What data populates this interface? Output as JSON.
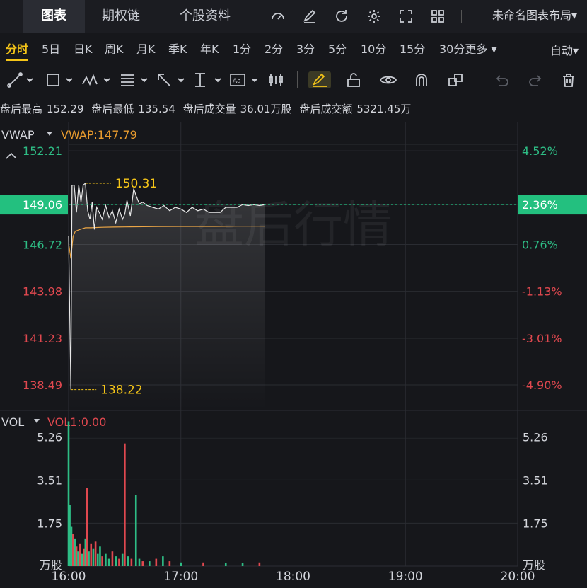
{
  "top_tabs": [
    {
      "label": "图表",
      "active": true
    },
    {
      "label": "期权链",
      "active": false
    },
    {
      "label": "个股资料",
      "active": false
    }
  ],
  "top_icons": [
    "gauge-icon",
    "edit-icon",
    "refresh-icon",
    "gear-icon",
    "fullscreen-icon",
    "grid-icon"
  ],
  "layout_name": "未命名图表布局",
  "periods": [
    {
      "label": "分时",
      "active": true
    },
    {
      "label": "5日"
    },
    {
      "label": "日K"
    },
    {
      "label": "周K"
    },
    {
      "label": "月K"
    },
    {
      "label": "季K"
    },
    {
      "label": "年K"
    },
    {
      "label": "1分"
    },
    {
      "label": "2分"
    },
    {
      "label": "3分"
    },
    {
      "label": "5分"
    },
    {
      "label": "10分"
    },
    {
      "label": "15分"
    },
    {
      "label": "30分更多"
    }
  ],
  "auto_label": "自动",
  "stats": {
    "high_label": "盘后最高",
    "high": "152.29",
    "low_label": "盘后最低",
    "low": "135.54",
    "vol_label": "盘后成交量",
    "vol": "36.01万股",
    "amt_label": "盘后成交额",
    "amt": "5321.45万"
  },
  "colors": {
    "up": "#2ebd85",
    "down": "#e0484f",
    "accent": "#f5c518",
    "vwap": "#e89b2e",
    "price": "#e8e8e8",
    "current": "#23c07f"
  },
  "chart_data": [
    {
      "type": "line",
      "indicator_name": "VWAP",
      "indicator_value": "VWAP:147.79",
      "watermark": "盘后行情",
      "x_ticks": [
        "16:00",
        "17:00",
        "18:00",
        "19:00",
        "20:00"
      ],
      "x_range_hours": [
        16,
        20
      ],
      "y_ticks_left": [
        "152.21",
        "146.72",
        "143.98",
        "141.23",
        "138.49"
      ],
      "y_ticks_left_values": [
        152.21,
        146.72,
        143.98,
        141.23,
        138.49
      ],
      "y_ticks_right": [
        "4.52%",
        "0.76%",
        "-1.13%",
        "-3.01%",
        "-4.90%"
      ],
      "ylim": [
        137.0,
        153.5
      ],
      "current_price": "149.06",
      "current_pct": "2.36%",
      "current_value": 149.06,
      "max_label": "150.31",
      "max_value": 150.31,
      "max_time": 16.15,
      "min_label": "138.22",
      "min_value": 138.22,
      "min_time": 16.02,
      "series": [
        {
          "role": "price",
          "x": [
            16.0,
            16.02,
            16.03,
            16.05,
            16.07,
            16.09,
            16.11,
            16.13,
            16.15,
            16.17,
            16.19,
            16.21,
            16.23,
            16.25,
            16.28,
            16.3,
            16.33,
            16.36,
            16.39,
            16.42,
            16.45,
            16.48,
            16.5,
            16.52,
            16.55,
            16.58,
            16.6,
            16.63,
            16.66,
            16.7,
            16.75,
            16.8,
            16.85,
            16.9,
            16.95,
            17.0,
            17.05,
            17.1,
            17.15,
            17.2,
            17.25,
            17.3,
            17.35,
            17.4,
            17.45,
            17.5,
            17.55,
            17.6,
            17.65,
            17.7,
            17.75
          ],
          "y": [
            147.2,
            138.22,
            150.2,
            150.2,
            148.6,
            150.2,
            149.2,
            150.2,
            150.31,
            148.7,
            148.2,
            149.2,
            147.6,
            148.9,
            148.5,
            148.2,
            149.0,
            148.3,
            148.7,
            148.0,
            148.8,
            148.2,
            148.5,
            149.3,
            148.4,
            150.0,
            149.6,
            149.1,
            149.2,
            149.0,
            148.9,
            148.8,
            149.0,
            148.7,
            148.9,
            148.8,
            148.6,
            148.9,
            148.7,
            148.8,
            148.6,
            148.6,
            148.6,
            148.9,
            148.9,
            148.9,
            149.06,
            149.0,
            149.06,
            149.0,
            149.06
          ]
        },
        {
          "role": "vwap",
          "x": [
            16.0,
            16.02,
            16.04,
            16.06,
            16.1,
            16.15,
            16.2,
            16.3,
            16.4,
            16.5,
            16.6,
            16.8,
            17.0,
            17.3,
            17.5,
            17.75
          ],
          "y": [
            146.8,
            145.9,
            147.2,
            147.5,
            147.6,
            147.7,
            147.7,
            147.73,
            147.74,
            147.75,
            147.76,
            147.77,
            147.78,
            147.78,
            147.79,
            147.79
          ]
        }
      ]
    },
    {
      "type": "bar",
      "indicator_name": "VOL",
      "indicator_value": "VOL1:0.00",
      "y_ticks": [
        "5.26",
        "3.51",
        "1.75"
      ],
      "y_ticks_values": [
        5.26,
        3.51,
        1.75
      ],
      "unit_label": "万股",
      "ylim": [
        0,
        6.0
      ],
      "bars": [
        {
          "x": 16.0,
          "v": 5.9,
          "c": "up"
        },
        {
          "x": 16.01,
          "v": 2.5,
          "c": "up"
        },
        {
          "x": 16.025,
          "v": 1.6,
          "c": "up"
        },
        {
          "x": 16.04,
          "v": 1.3,
          "c": "down"
        },
        {
          "x": 16.055,
          "v": 1.1,
          "c": "up"
        },
        {
          "x": 16.07,
          "v": 0.8,
          "c": "down"
        },
        {
          "x": 16.085,
          "v": 0.6,
          "c": "up"
        },
        {
          "x": 16.1,
          "v": 0.9,
          "c": "down"
        },
        {
          "x": 16.12,
          "v": 0.5,
          "c": "up"
        },
        {
          "x": 16.14,
          "v": 0.7,
          "c": "down"
        },
        {
          "x": 16.15,
          "v": 1.1,
          "c": "up"
        },
        {
          "x": 16.165,
          "v": 3.2,
          "c": "down"
        },
        {
          "x": 16.18,
          "v": 0.6,
          "c": "up"
        },
        {
          "x": 16.2,
          "v": 0.9,
          "c": "down"
        },
        {
          "x": 16.22,
          "v": 0.7,
          "c": "up"
        },
        {
          "x": 16.24,
          "v": 1.0,
          "c": "down"
        },
        {
          "x": 16.26,
          "v": 0.5,
          "c": "up"
        },
        {
          "x": 16.28,
          "v": 0.8,
          "c": "up"
        },
        {
          "x": 16.3,
          "v": 0.4,
          "c": "down"
        },
        {
          "x": 16.33,
          "v": 0.5,
          "c": "up"
        },
        {
          "x": 16.36,
          "v": 0.3,
          "c": "up"
        },
        {
          "x": 16.39,
          "v": 0.6,
          "c": "down"
        },
        {
          "x": 16.42,
          "v": 0.4,
          "c": "up"
        },
        {
          "x": 16.45,
          "v": 0.3,
          "c": "down"
        },
        {
          "x": 16.48,
          "v": 0.5,
          "c": "up"
        },
        {
          "x": 16.5,
          "v": 5.0,
          "c": "down"
        },
        {
          "x": 16.53,
          "v": 0.4,
          "c": "up"
        },
        {
          "x": 16.56,
          "v": 0.3,
          "c": "down"
        },
        {
          "x": 16.6,
          "v": 2.9,
          "c": "up"
        },
        {
          "x": 16.63,
          "v": 0.3,
          "c": "up"
        },
        {
          "x": 16.66,
          "v": 0.2,
          "c": "down"
        },
        {
          "x": 16.72,
          "v": 0.2,
          "c": "up"
        },
        {
          "x": 16.78,
          "v": 0.3,
          "c": "down"
        },
        {
          "x": 16.84,
          "v": 0.4,
          "c": "up"
        },
        {
          "x": 16.9,
          "v": 0.2,
          "c": "down"
        },
        {
          "x": 17.0,
          "v": 0.15,
          "c": "up"
        },
        {
          "x": 17.2,
          "v": 0.15,
          "c": "down"
        },
        {
          "x": 17.4,
          "v": 0.12,
          "c": "up"
        },
        {
          "x": 17.55,
          "v": 0.12,
          "c": "up"
        },
        {
          "x": 17.7,
          "v": 0.15,
          "c": "down"
        }
      ]
    }
  ]
}
